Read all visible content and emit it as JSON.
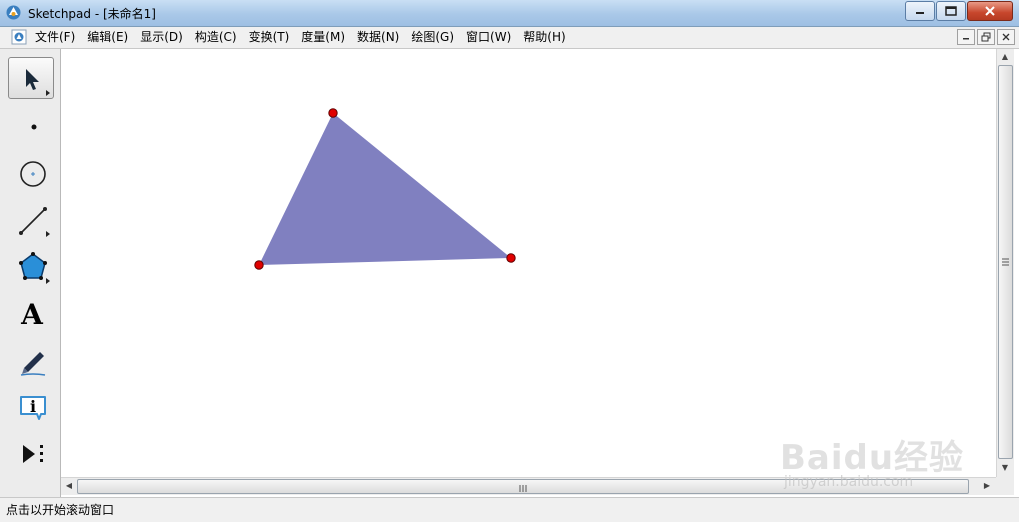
{
  "window": {
    "title": "Sketchpad  - [未命名1]",
    "controls": [
      "minimize",
      "maximize",
      "close"
    ]
  },
  "menubar": {
    "items": [
      {
        "label": "文件(F)"
      },
      {
        "label": "编辑(E)"
      },
      {
        "label": "显示(D)"
      },
      {
        "label": "构造(C)"
      },
      {
        "label": "变换(T)"
      },
      {
        "label": "度量(M)"
      },
      {
        "label": "数据(N)"
      },
      {
        "label": "绘图(G)"
      },
      {
        "label": "窗口(W)"
      },
      {
        "label": "帮助(H)"
      }
    ]
  },
  "toolbox": {
    "tools": [
      {
        "name": "arrow-select-tool",
        "icon": "arrow-pointer-icon",
        "active": true
      },
      {
        "name": "point-tool",
        "icon": "point-icon"
      },
      {
        "name": "compass-tool",
        "icon": "circle-icon"
      },
      {
        "name": "straightedge-tool",
        "icon": "segment-icon"
      },
      {
        "name": "polygon-tool",
        "icon": "pentagon-icon"
      },
      {
        "name": "text-tool",
        "icon": "text-a-icon",
        "glyph": "A"
      },
      {
        "name": "marker-tool",
        "icon": "marker-pen-icon"
      },
      {
        "name": "information-tool",
        "icon": "info-icon",
        "glyph": "i"
      },
      {
        "name": "custom-tool",
        "icon": "play-menu-icon"
      }
    ]
  },
  "canvas": {
    "shape": "triangle",
    "fill_color": "#8080c0",
    "vertex_color": "#e00000"
  },
  "statusbar": {
    "text": "点击以开始滚动窗口"
  },
  "watermark": {
    "logo": "Baidu经验",
    "url": "jingyan.baidu.com"
  }
}
